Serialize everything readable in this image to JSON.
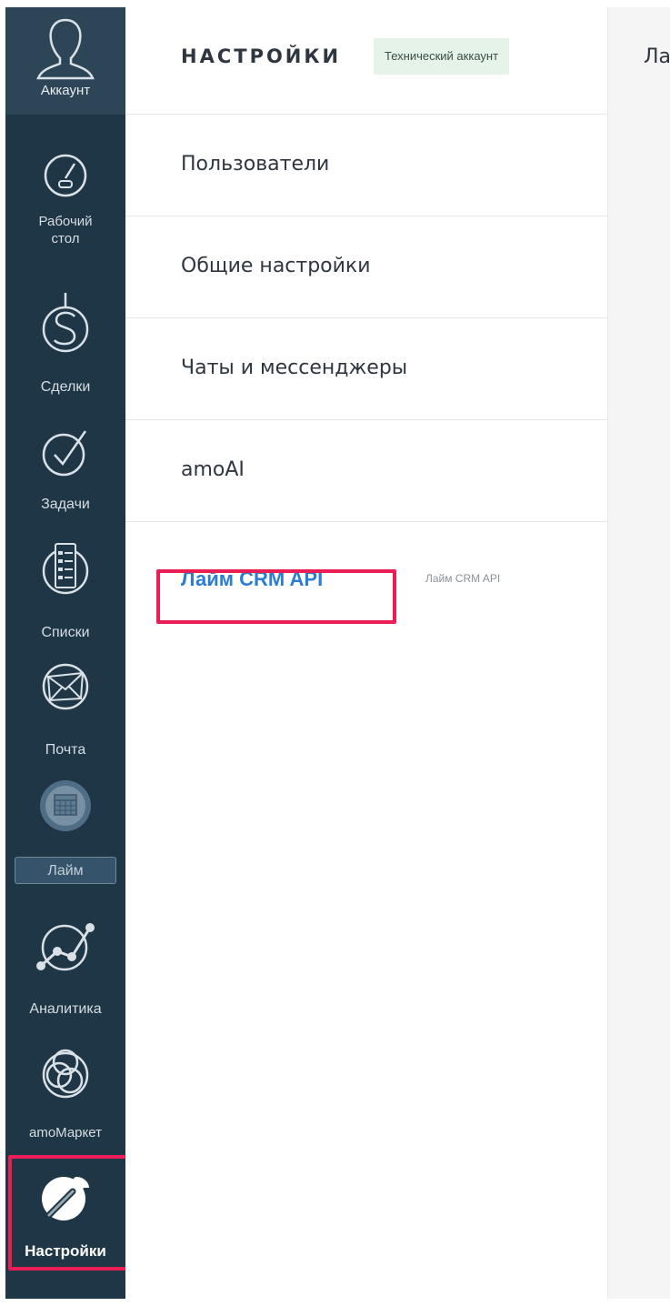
{
  "sidebar": {
    "account_label": "Аккаунт",
    "items": [
      {
        "label": "Рабочий\nстол",
        "icon": "speedometer-icon"
      },
      {
        "label": "Сделки",
        "icon": "dollar-icon"
      },
      {
        "label": "Задачи",
        "icon": "checkmark-icon"
      },
      {
        "label": "Списки",
        "icon": "list-icon"
      },
      {
        "label": "Почта",
        "icon": "envelope-icon"
      },
      {
        "label": "Лайм",
        "icon": "calendar-icon"
      },
      {
        "label": "Аналитика",
        "icon": "chart-icon"
      },
      {
        "label": "amoМаркет",
        "icon": "market-icon"
      },
      {
        "label": "Настройки",
        "icon": "wrench-icon",
        "active": true
      }
    ]
  },
  "panel": {
    "title": "НАСТРОЙКИ",
    "badge": "Технический аккаунт",
    "menu": [
      {
        "label": "Пользователи"
      },
      {
        "label": "Общие настройки"
      },
      {
        "label": "Чаты и мессенджеры"
      },
      {
        "label": "amoAI"
      }
    ],
    "widget": {
      "name": "Лайм CRM API",
      "subtitle": "Лайм CRM API"
    }
  },
  "content": {
    "title": "Лайм CRM API"
  },
  "colors": {
    "sidebar_bg": "#1f3646",
    "link": "#2b7cd3",
    "highlight": "#ea1d54",
    "badge_bg": "#e6f3e9"
  }
}
